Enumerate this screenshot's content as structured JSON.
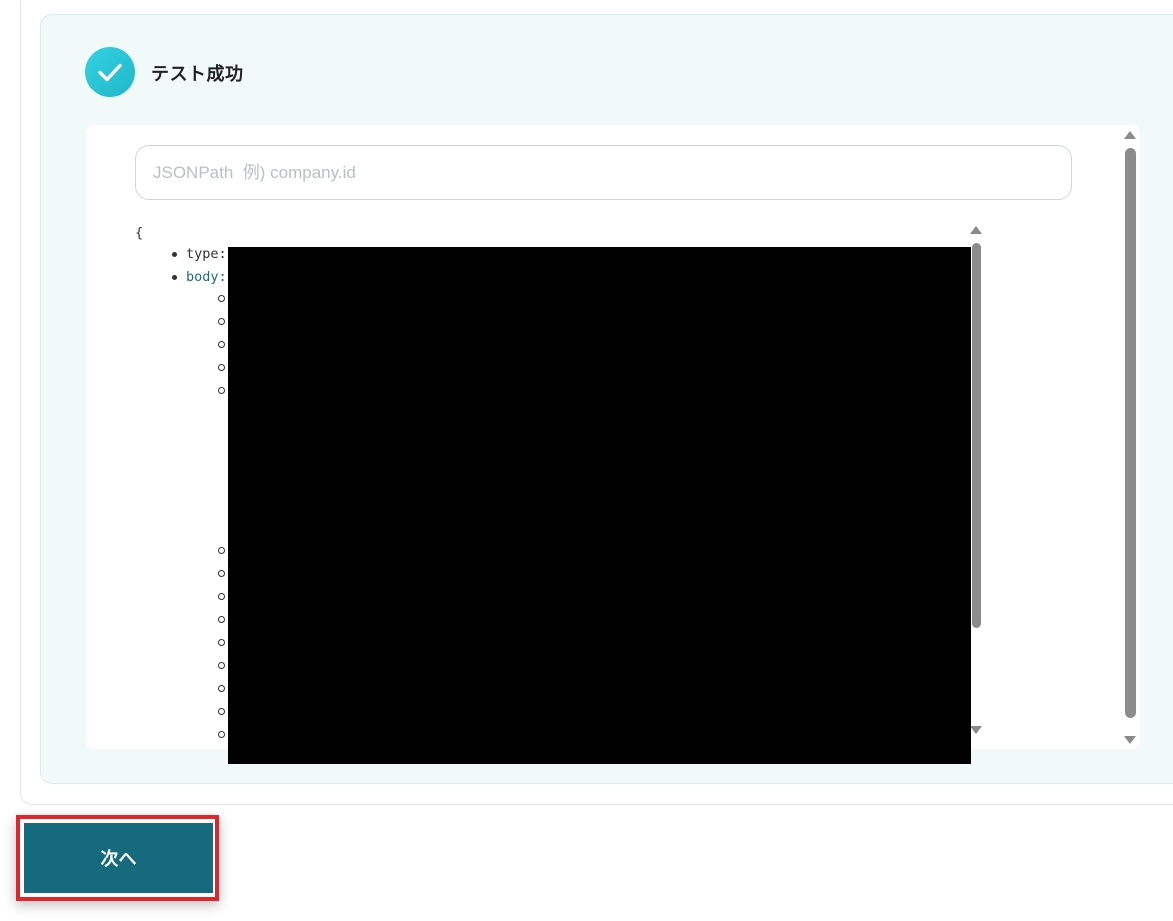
{
  "result": {
    "title": "テスト成功",
    "icon": "check-circle-icon",
    "accent_color": "#1fb7c9"
  },
  "jsonpath": {
    "placeholder": "JSONPath  例) company.id",
    "value": ""
  },
  "json_tree": {
    "open_brace": "{",
    "items": [
      {
        "key": "type:"
      },
      {
        "key": "body:"
      }
    ]
  },
  "footer": {
    "next_label": "次へ",
    "button_color": "#156b7d",
    "highlight_color": "#e0252b"
  }
}
